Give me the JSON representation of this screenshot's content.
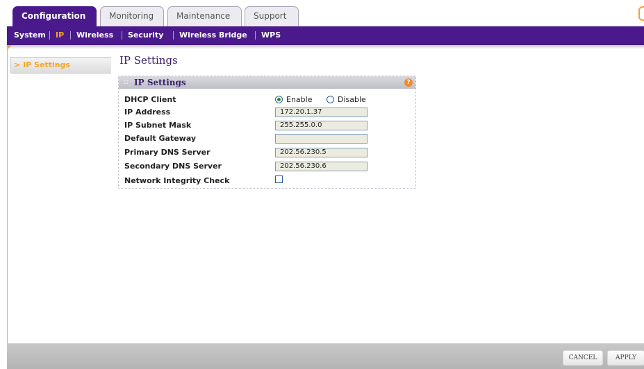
{
  "tabs": {
    "configuration": "Configuration",
    "monitoring": "Monitoring",
    "maintenance": "Maintenance",
    "support": "Support"
  },
  "subnav": {
    "system": "System",
    "ip": "IP",
    "wireless": "Wireless",
    "security": "Security",
    "wireless_bridge": "Wireless Bridge",
    "wps": "WPS"
  },
  "sidebar": {
    "items": [
      {
        "label": "> IP Settings"
      }
    ]
  },
  "page": {
    "title": "IP Settings"
  },
  "panel": {
    "title": "IP Settings",
    "help_icon": "?",
    "fields": {
      "dhcp_client": {
        "label": "DHCP Client",
        "enable": "Enable",
        "disable": "Disable",
        "selected": "Enable"
      },
      "ip_address": {
        "label": "IP Address",
        "value": "172.20.1.37"
      },
      "subnet_mask": {
        "label": "IP Subnet Mask",
        "value": "255.255.0.0"
      },
      "default_gateway": {
        "label": "Default Gateway",
        "value": ""
      },
      "primary_dns": {
        "label": "Primary DNS Server",
        "value": "202.56.230.5"
      },
      "secondary_dns": {
        "label": "Secondary DNS Server",
        "value": "202.56.230.6"
      },
      "network_integrity": {
        "label": "Network Integrity Check",
        "checked": false
      }
    }
  },
  "footer": {
    "cancel": "CANCEL",
    "apply": "APPLY"
  },
  "colors": {
    "brand_purple": "#4a1a8c",
    "accent_orange": "#f5a623"
  },
  "icons": {
    "help": "help-icon",
    "grip": "drag-grip-icon"
  }
}
